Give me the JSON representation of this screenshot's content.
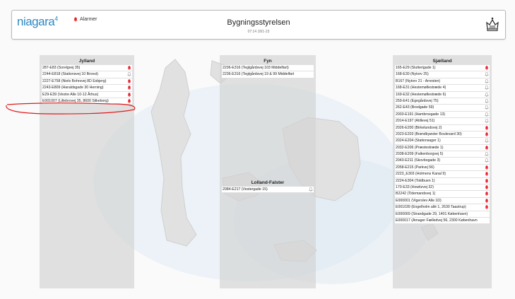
{
  "header": {
    "logo_text": "niagara",
    "logo_sup": "4",
    "alarm_label": "Alarmer",
    "title": "Bygningsstyrelsen",
    "subtitle": "07:14 18/1-23",
    "crest_icon": "crown-icon"
  },
  "colors": {
    "bell_active": "#e8212b",
    "bell_inactive": "#999999",
    "logo": "#2e88c4"
  },
  "jylland": {
    "title": "Jylland",
    "rows": [
      {
        "label": "287-E83 (Sorelgvej 35)",
        "alarm": true
      },
      {
        "label": "2244-E818 (Stationsvej 10 Brovst)",
        "alarm": false
      },
      {
        "label": "2227-E758 (Niels Bohrsvej 8D Esbjerg)",
        "alarm": true
      },
      {
        "label": "2243-E809 (Haraldsgade 30 Herning)",
        "alarm": true
      },
      {
        "label": "E29-E39 (Vestre Alle 10-12 Århus)",
        "alarm": true
      },
      {
        "label": "E001007 (Lillebrovej 35, 8600 Silkeborg)",
        "alarm": true
      }
    ]
  },
  "fyn": {
    "title": "Fyn",
    "rows": [
      {
        "label": "2236-E316 (Teglgårdsvej 103 Middelfart)"
      },
      {
        "label": "2236-E316 (Teglgårdsvej 19 & 99 Middelfart"
      }
    ]
  },
  "lolland": {
    "title": "Lolland-Falster",
    "rows": [
      {
        "label": "2084-E217 (Vestergade 15)",
        "alarm": false
      }
    ]
  },
  "sjaelland": {
    "title": "Sjælland",
    "rows": [
      {
        "label": "165-E29 (Slutterigade 1)",
        "alarm": true
      },
      {
        "label": "168-E30 (Nytorv 25)",
        "alarm": false
      },
      {
        "label": "B167 (Nytorv 21 - Arresten)",
        "alarm": false
      },
      {
        "label": "168-E31 (Hestemøllestræde 4)",
        "alarm": false
      },
      {
        "label": "169-E32 (Hestemøllestræde 6)",
        "alarm": false
      },
      {
        "label": "259-E41 (Egegårdsvej 75)",
        "alarm": false
      },
      {
        "label": "262-E43 (Bredgade 59)",
        "alarm": false
      },
      {
        "label": "2003-E191 (Hambrosgade 13)",
        "alarm": false
      },
      {
        "label": "2014-E197 (Atillevej 51)",
        "alarm": false
      },
      {
        "label": "2026-E200 (Birkelundsvej 2)",
        "alarm": true
      },
      {
        "label": "2023-E203 (Brøndbyøster Boulevard 30)",
        "alarm": true
      },
      {
        "label": "2024-E204 (Stationsager 1)",
        "alarm": false
      },
      {
        "label": "2032-E206 (Præstestræde 1)",
        "alarm": true
      },
      {
        "label": "2038-E209 (Falkenborgvej 5)",
        "alarm": false
      },
      {
        "label": "2043-E211 (Skovbogade 3)",
        "alarm": false
      },
      {
        "label": "2058-E215 (Parkvej 56)",
        "alarm": true
      },
      {
        "label": "2223_E303 (Holmens Kanal 9)",
        "alarm": true
      },
      {
        "label": "2224-E304 (Toldbuen 1)",
        "alarm": true
      },
      {
        "label": "170-E33 (Howitzvej 32)",
        "alarm": true
      },
      {
        "label": "B2242 (Tidemandsvej 1)",
        "alarm": true
      },
      {
        "label": "E000001 (Vigerslev Alle 1D)",
        "alarm": true
      },
      {
        "label": "E001039 (Engelholm allé 1, 2630 Taastrup)",
        "alarm": true
      },
      {
        "label": "E000069 (Strandgade 29, 1401 København)",
        "alarm": null
      },
      {
        "label": "E000017 (Amager Fælledvej 56, 2300 København",
        "alarm": null
      }
    ]
  }
}
